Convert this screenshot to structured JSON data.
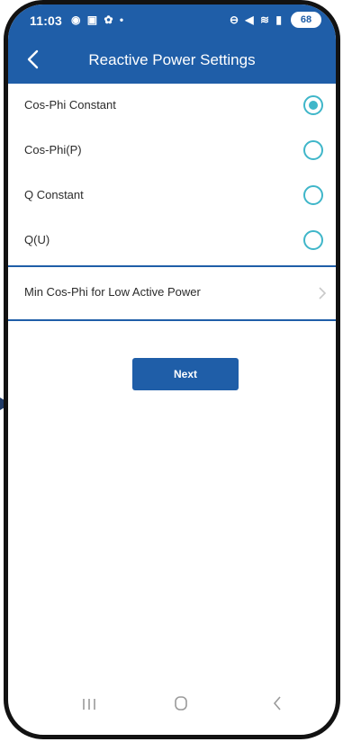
{
  "status_bar": {
    "time": "11:03",
    "left_icons": "◉ ▣ ✿ •",
    "right_icons": "⊖ ◀ ≋ ▮",
    "battery": "68"
  },
  "header": {
    "title": "Reactive Power Settings"
  },
  "options": [
    {
      "label": "Cos-Phi Constant",
      "selected": true
    },
    {
      "label": "Cos-Phi(P)",
      "selected": false
    },
    {
      "label": "Q Constant",
      "selected": false
    },
    {
      "label": "Q(U)",
      "selected": false
    }
  ],
  "min_cosphi": {
    "label": "Min Cos-Phi for Low Active Power"
  },
  "next_button": {
    "label": "Next"
  },
  "colors": {
    "header_blue": "#1f5ea8",
    "radio_accent": "#3fb6c9"
  }
}
